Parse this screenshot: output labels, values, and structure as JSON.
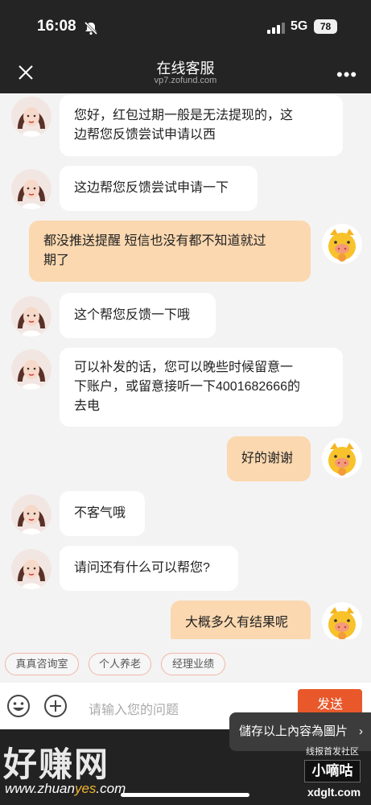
{
  "status_bar": {
    "time": "16:08",
    "network": "5G",
    "battery": "78"
  },
  "nav": {
    "title": "在线客服",
    "subtitle": "vp7.zofund.com"
  },
  "messages": [
    {
      "side": "agent",
      "lines": [
        "您好，红包过期一般是无法提现的，这",
        "边帮您反馈尝试申请以西"
      ]
    },
    {
      "side": "agent",
      "lines": [
        "这边帮您反馈尝试申请一下"
      ]
    },
    {
      "side": "user",
      "lines": [
        "都没推送提醒 短信也没有都不知道就过",
        "期了"
      ]
    },
    {
      "side": "agent",
      "lines": [
        "这个帮您反馈一下哦"
      ]
    },
    {
      "side": "agent",
      "lines": [
        "可以补发的话，您可以晚些时候留意一",
        "下账户，或留意接听一下4001682666的",
        "去电"
      ]
    },
    {
      "side": "user",
      "lines": [
        "好的谢谢"
      ]
    },
    {
      "side": "agent",
      "lines": [
        "不客气哦"
      ]
    },
    {
      "side": "agent",
      "lines": [
        "请问还有什么可以帮您?"
      ]
    },
    {
      "side": "user",
      "lines": [
        "大概多久有结果呢"
      ]
    }
  ],
  "quick_chips": [
    "真真咨询室",
    "个人养老",
    "经理业绩"
  ],
  "input": {
    "placeholder": "请输入您的问题",
    "send_label": "发送"
  },
  "overlay": {
    "save_tooltip": "儲存以上內容為圖片",
    "watermark": "好赚网",
    "watermark_url_a": "www.zhuan",
    "watermark_url_b": "yes",
    "watermark_url_c": ".com",
    "brand_line1": "线报首发社区",
    "brand_line2": "小嘀咕",
    "brand_line3": "xdglt.com"
  },
  "colors": {
    "accent": "#e8582a",
    "user_bubble": "#fbd8b0",
    "header": "#242424"
  }
}
